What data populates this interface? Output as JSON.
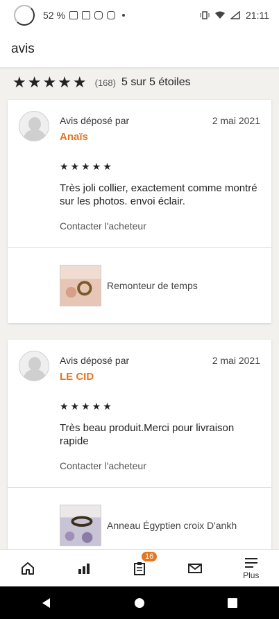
{
  "status": {
    "battery": "52 %",
    "time": "21:11"
  },
  "appbar": {
    "title": "avis"
  },
  "summary": {
    "stars": "★★★★★",
    "count": "(168)",
    "outof": "5 sur 5 étoiles"
  },
  "reviews": [
    {
      "deposit_label": "Avis déposé par",
      "date": "2 mai 2021",
      "author": "Anaïs",
      "stars": "★★★★★",
      "text": "Très joli collier, exactement comme montré sur les photos. envoi éclair.",
      "contact": "Contacter l'acheteur",
      "product": "Remonteur de temps"
    },
    {
      "deposit_label": "Avis déposé par",
      "date": "2 mai 2021",
      "author": "LE CID",
      "stars": "★★★★★",
      "text": "Très beau produit.Merci pour livraison rapide",
      "contact": "Contacter l'acheteur",
      "product": "Anneau Égyptien croix D'ankh"
    }
  ],
  "nav": {
    "badge": "16",
    "more_label": "Plus"
  },
  "colors": {
    "accent": "#e6761f"
  }
}
